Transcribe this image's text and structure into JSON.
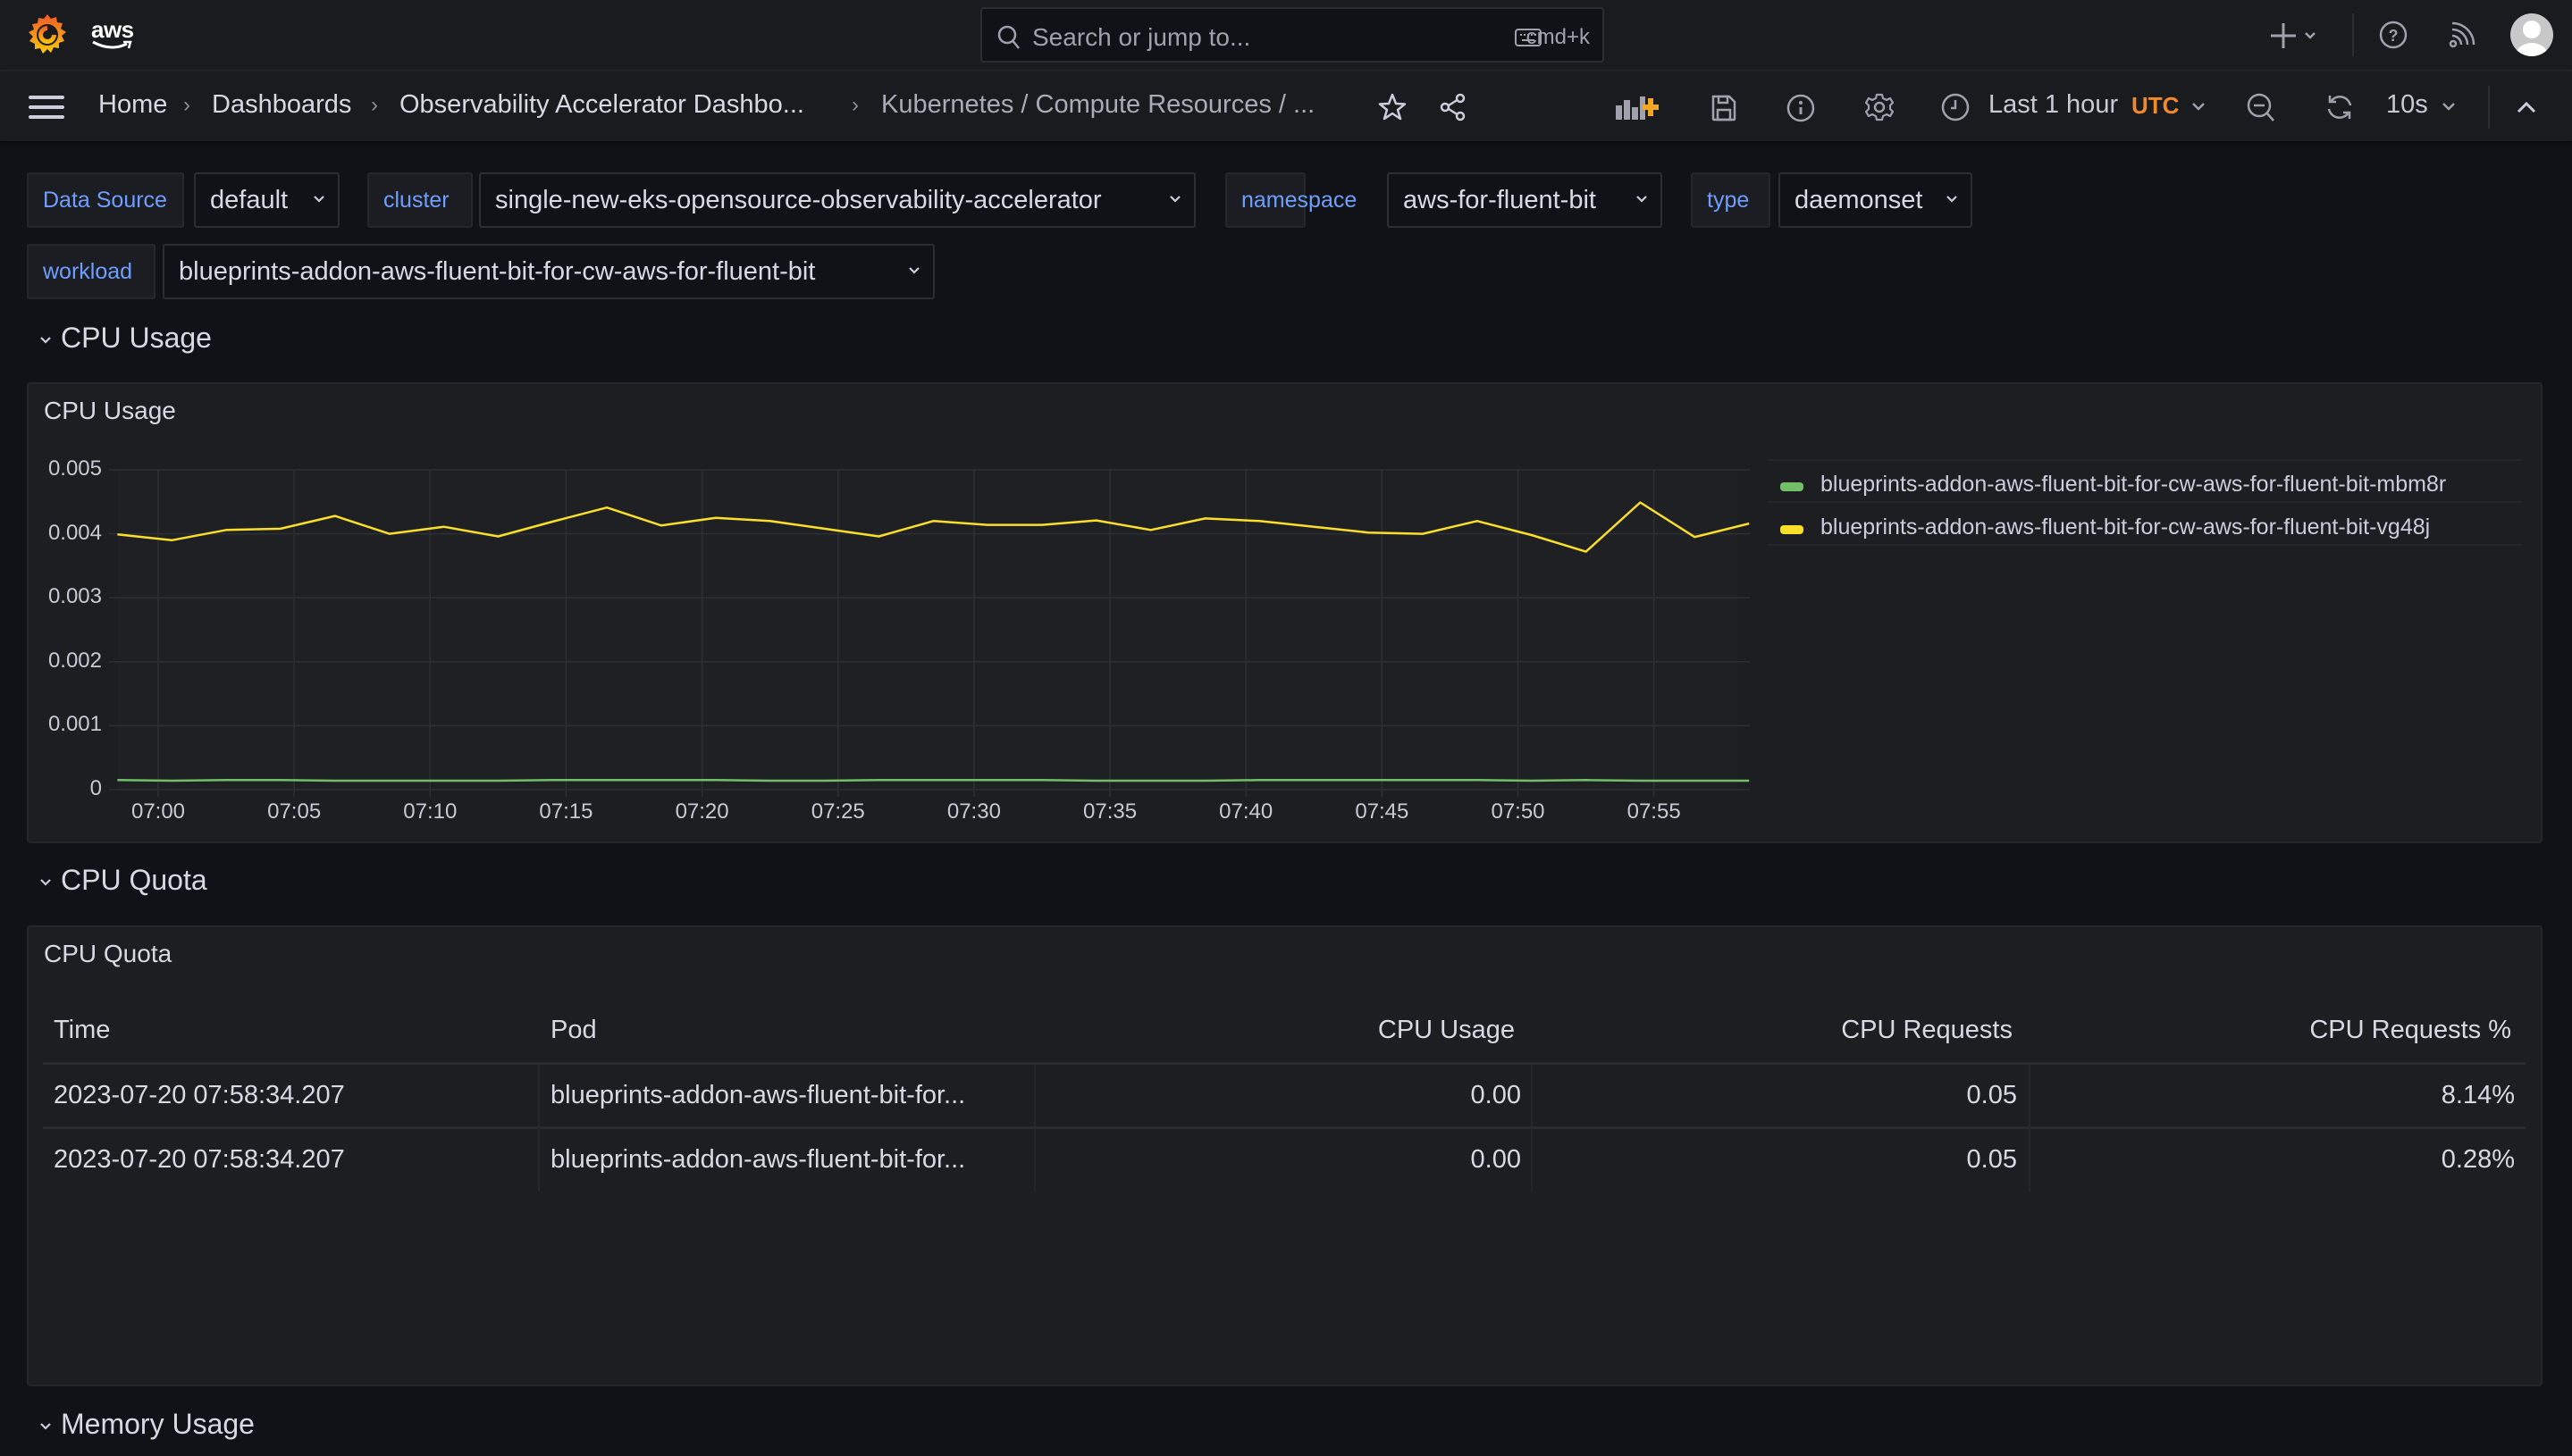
{
  "topbar": {
    "brand": "aws",
    "search_placeholder": "Search or jump to...",
    "search_shortcut": "cmd+k",
    "icons": [
      "grafana-logo-icon",
      "plus-icon",
      "help-icon",
      "news-feed-icon",
      "user-avatar"
    ]
  },
  "navbar": {
    "breadcrumbs": [
      "Home",
      "Dashboards",
      "Observability Accelerator Dashbo...",
      "Kubernetes / Compute Resources / ..."
    ],
    "time_range": "Last 1 hour",
    "timezone": "UTC",
    "refresh_interval": "10s",
    "icons": [
      "menu-icon",
      "star-icon",
      "share-icon",
      "add-panel-icon",
      "save-icon",
      "info-icon",
      "settings-icon",
      "clock-icon",
      "zoom-out-icon",
      "refresh-icon",
      "collapse-icon"
    ]
  },
  "variables": [
    {
      "label": "Data Source",
      "value": "default"
    },
    {
      "label": "cluster",
      "value": "single-new-eks-opensource-observability-accelerator"
    },
    {
      "label": "namespace",
      "value": "aws-for-fluent-bit"
    },
    {
      "label": "type",
      "value": "daemonset"
    },
    {
      "label": "workload",
      "value": "blueprints-addon-aws-fluent-bit-for-cw-aws-for-fluent-bit"
    }
  ],
  "rows": {
    "cpu_usage": "CPU Usage",
    "cpu_quota": "CPU Quota",
    "memory_usage": "Memory Usage"
  },
  "cpu_usage_panel": {
    "title": "CPU Usage"
  },
  "chart_data": {
    "type": "line",
    "title": "CPU Usage",
    "xlabel": "",
    "ylabel": "",
    "ylim": [
      0,
      0.005
    ],
    "yticks": [
      0,
      0.001,
      0.002,
      0.003,
      0.004,
      0.005
    ],
    "ytick_labels": [
      "0",
      "0.001",
      "0.002",
      "0.003",
      "0.004",
      "0.005"
    ],
    "xticks": [
      "07:00",
      "07:05",
      "07:10",
      "07:15",
      "07:20",
      "07:25",
      "07:30",
      "07:35",
      "07:40",
      "07:45",
      "07:50",
      "07:55"
    ],
    "x_start_minutes": -1.5,
    "x_step_minutes": 2,
    "grid": true,
    "legend_position": "right",
    "series": [
      {
        "name": "blueprints-addon-aws-fluent-bit-for-cw-aws-for-fluent-bit-mbm8r",
        "color": "#73bf69",
        "values": [
          0.00015,
          0.00014,
          0.00015,
          0.00015,
          0.00014,
          0.00014,
          0.00014,
          0.00014,
          0.00015,
          0.00015,
          0.00015,
          0.00015,
          0.00014,
          0.00014,
          0.00015,
          0.00015,
          0.00015,
          0.00015,
          0.00014,
          0.00014,
          0.00014,
          0.00015,
          0.00015,
          0.00015,
          0.00015,
          0.00015,
          0.00014,
          0.00015,
          0.00014,
          0.00014,
          0.00014
        ]
      },
      {
        "name": "blueprints-addon-aws-fluent-bit-for-cw-aws-for-fluent-bit-vg48j",
        "color": "#fade2a",
        "values": [
          0.00399,
          0.0039,
          0.00406,
          0.00408,
          0.00428,
          0.004,
          0.00411,
          0.00396,
          0.00419,
          0.00441,
          0.00413,
          0.00425,
          0.0042,
          0.00408,
          0.00396,
          0.0042,
          0.00414,
          0.00414,
          0.00421,
          0.00406,
          0.00424,
          0.0042,
          0.00411,
          0.00402,
          0.004,
          0.0042,
          0.00398,
          0.00372,
          0.00449,
          0.00395,
          0.00416
        ]
      }
    ]
  },
  "cpu_quota_panel": {
    "title": "CPU Quota",
    "columns": [
      "Time",
      "Pod",
      "CPU Usage",
      "CPU Requests",
      "CPU Requests %"
    ],
    "rows": [
      [
        "2023-07-20 07:58:34.207",
        "blueprints-addon-aws-fluent-bit-for...",
        "0.00",
        "0.05",
        "8.14%"
      ],
      [
        "2023-07-20 07:58:34.207",
        "blueprints-addon-aws-fluent-bit-for...",
        "0.00",
        "0.05",
        "0.28%"
      ]
    ]
  },
  "colors": {
    "accent_orange": "#f08a2a",
    "variable_label_blue": "#6e9fff",
    "series_green": "#73bf69",
    "series_yellow": "#fade2a"
  }
}
